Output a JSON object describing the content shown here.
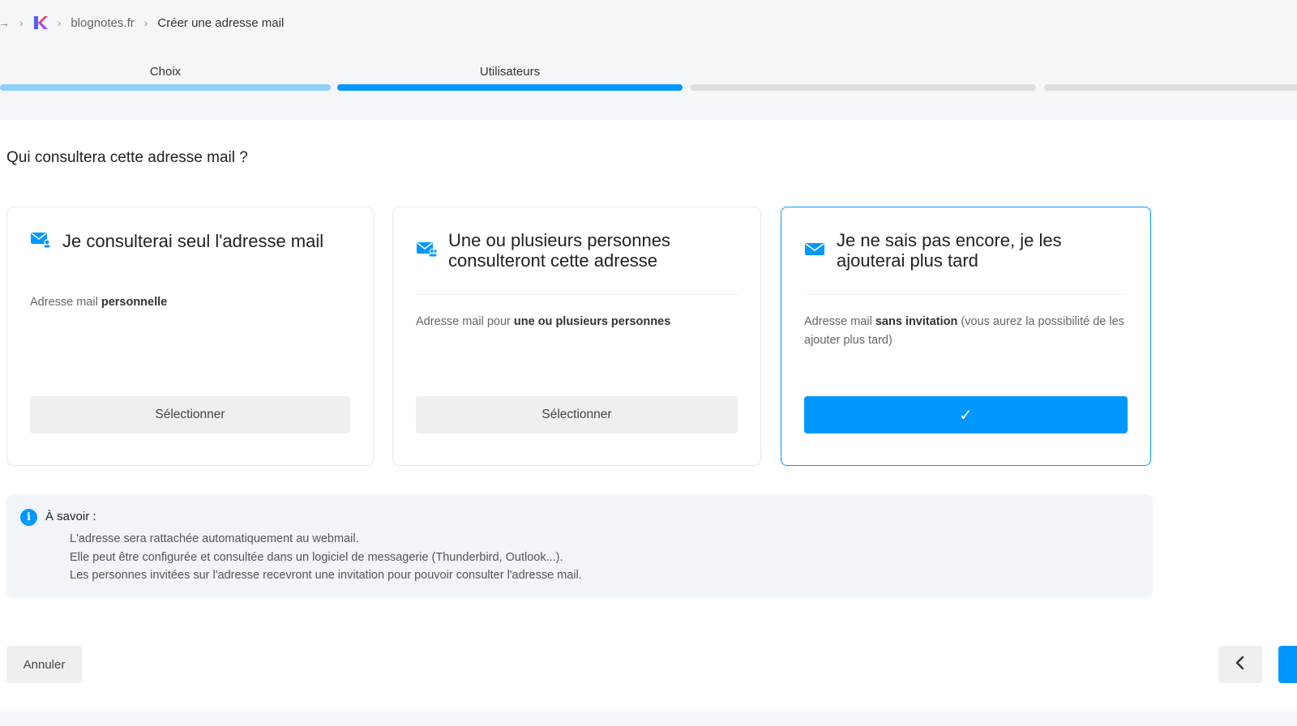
{
  "breadcrumb": {
    "items": [
      {
        "label": "blognotes.fr"
      },
      {
        "label": "Créer une adresse mail"
      }
    ]
  },
  "steps": [
    {
      "label": "Choix",
      "state": "done"
    },
    {
      "label": "Utilisateurs",
      "state": "active"
    },
    {
      "label": "",
      "state": "todo"
    },
    {
      "label": "",
      "state": "todo"
    }
  ],
  "question": "Qui consultera cette adresse mail ?",
  "cards": [
    {
      "title": "Je consulterai seul l'adresse mail",
      "desc_prefix": "Adresse mail ",
      "desc_bold": "personnelle",
      "desc_suffix": "",
      "button": "Sélectionner",
      "selected": false,
      "icon": "envelope-user-icon"
    },
    {
      "title": "Une ou plusieurs personnes consulteront cette adresse",
      "desc_prefix": "Adresse mail pour ",
      "desc_bold": "une ou plusieurs personnes",
      "desc_suffix": "",
      "button": "Sélectionner",
      "selected": false,
      "icon": "envelope-users-icon"
    },
    {
      "title": "Je ne sais pas encore, je les ajouterai plus tard",
      "desc_prefix": "Adresse mail ",
      "desc_bold": "sans invitation",
      "desc_suffix": " (vous aurez la possibilité de les ajouter plus tard)",
      "button": "✓",
      "selected": true,
      "icon": "envelope-icon"
    }
  ],
  "info": {
    "title": "À savoir :",
    "lines": [
      "L'adresse sera rattachée automatiquement au webmail.",
      "Elle peut être configurée et consultée dans un logiciel de messagerie (Thunderbird, Outlook...).",
      "Les personnes invitées sur l'adresse recevront une invitation pour pouvoir consulter l'adresse mail."
    ]
  },
  "footer": {
    "cancel": "Annuler"
  },
  "colors": {
    "accent": "#0098ff",
    "step_done": "#8fd0fb",
    "step_active": "#0098ff",
    "step_todo": "#dcdee2",
    "brand_k_1": "#e63f7a",
    "brand_k_2": "#5b5bf5"
  }
}
